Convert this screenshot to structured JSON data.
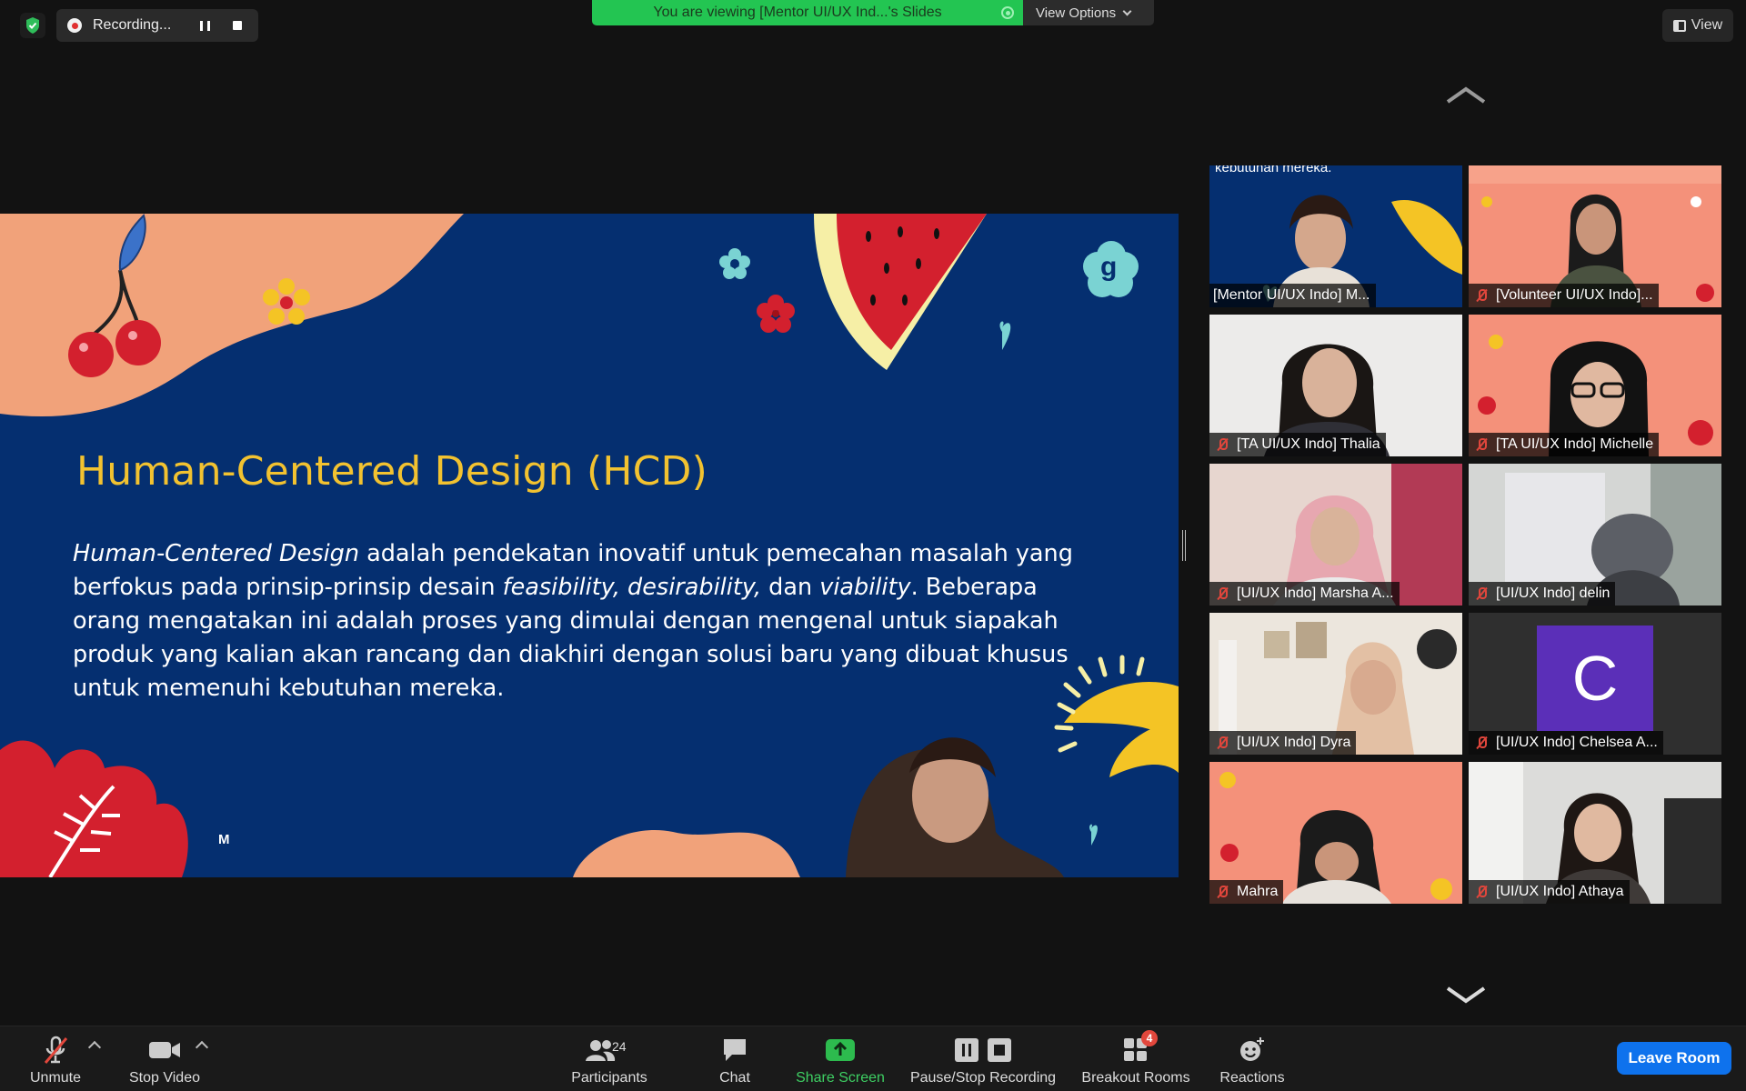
{
  "top": {
    "recording_label": "Recording...",
    "viewing_banner": "You are viewing [Mentor UI/UX Ind...'s Slides",
    "view_options": "View Options",
    "view_button": "View"
  },
  "slide": {
    "title": "Human-Centered Design (HCD)",
    "body_part1": "Human-Centered Design",
    "body_part2": " adalah pendekatan inovatif untuk pemecahan masalah yang berfokus pada prinsip-prinsip desain ",
    "body_part3": "feasibility, desirability,",
    "body_part4": " dan ",
    "body_part5": "viability",
    "body_part6": ". Beberapa orang mengatakan ini adalah proses yang dimulai dengan mengenal untuk siapakah produk yang kalian akan rancang dan diakhiri dengan solusi baru yang dibuat khusus untuk memenuhi kebutuhan mereka.",
    "corner_mark": "M",
    "logo_letter": "g"
  },
  "gallery": {
    "active_overlay_text": "kebutuhan mereka.",
    "participants": [
      {
        "name": "[Mentor UI/UX Indo] M...",
        "muted": false,
        "active": true
      },
      {
        "name": "[Volunteer UI/UX Indo]...",
        "muted": true,
        "active": false
      },
      {
        "name": "[TA UI/UX Indo] Thalia",
        "muted": true,
        "active": false
      },
      {
        "name": "[TA UI/UX Indo] Michelle",
        "muted": true,
        "active": false
      },
      {
        "name": "[UI/UX Indo] Marsha A...",
        "muted": true,
        "active": false
      },
      {
        "name": "[UI/UX Indo] delin",
        "muted": true,
        "active": false
      },
      {
        "name": "[UI/UX Indo] Dyra",
        "muted": true,
        "active": false
      },
      {
        "name": "[UI/UX Indo] Chelsea A...",
        "muted": true,
        "active": false
      },
      {
        "name": "Mahra",
        "muted": true,
        "active": false
      },
      {
        "name": "[UI/UX Indo] Athaya",
        "muted": true,
        "active": false
      }
    ],
    "avatar_letter": "C"
  },
  "toolbar": {
    "unmute": "Unmute",
    "stop_video": "Stop Video",
    "participants": "Participants",
    "participants_count": "24",
    "chat": "Chat",
    "share_screen": "Share Screen",
    "pause_stop_recording": "Pause/Stop Recording",
    "breakout_rooms": "Breakout Rooms",
    "breakout_badge": "4",
    "reactions": "Reactions",
    "leave_room": "Leave Room"
  },
  "colors": {
    "slide_bg": "#052f70",
    "slide_title": "#f2c230",
    "banner_green": "#23c552",
    "leave_blue": "#0e72ed",
    "active_speaker": "#dbe15a"
  }
}
